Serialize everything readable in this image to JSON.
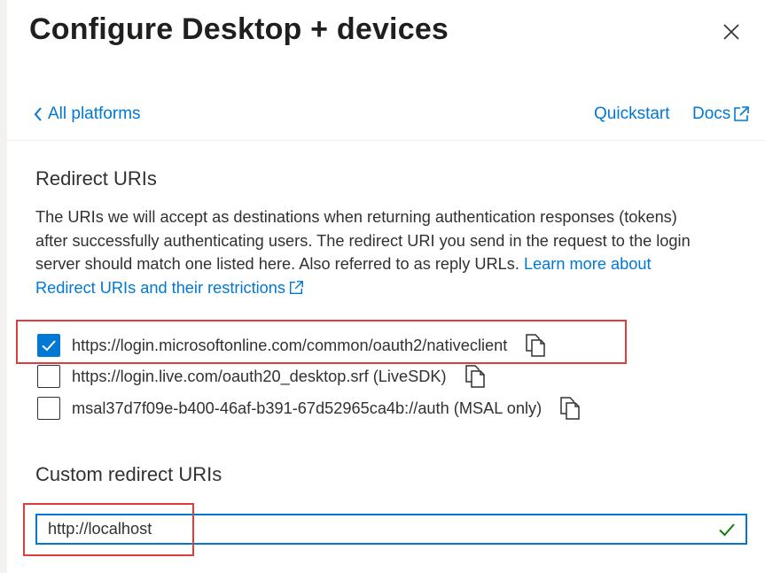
{
  "panel": {
    "title": "Configure Desktop + devices",
    "back_link": "All platforms",
    "quickstart_link": "Quickstart",
    "docs_link": "Docs"
  },
  "redirect": {
    "heading": "Redirect URIs",
    "description": "The URIs we will accept as destinations when returning authentication responses (tokens) after successfully authenticating users. The redirect URI you send in the request to the login server should match one listed here. Also referred to as reply URLs.",
    "learn_more": "Learn more about Redirect URIs and their restrictions",
    "uris": [
      {
        "label": "https://login.microsoftonline.com/common/oauth2/nativeclient",
        "checked": true
      },
      {
        "label": "https://login.live.com/oauth20_desktop.srf (LiveSDK)",
        "checked": false
      },
      {
        "label": "msal37d7f09e-b400-46af-b391-67d52965ca4b://auth (MSAL only)",
        "checked": false
      }
    ]
  },
  "custom": {
    "heading": "Custom redirect URIs",
    "value": "http://localhost"
  },
  "colors": {
    "accent": "#0078d4",
    "success": "#107c10",
    "annotation": "#e03c3c"
  }
}
